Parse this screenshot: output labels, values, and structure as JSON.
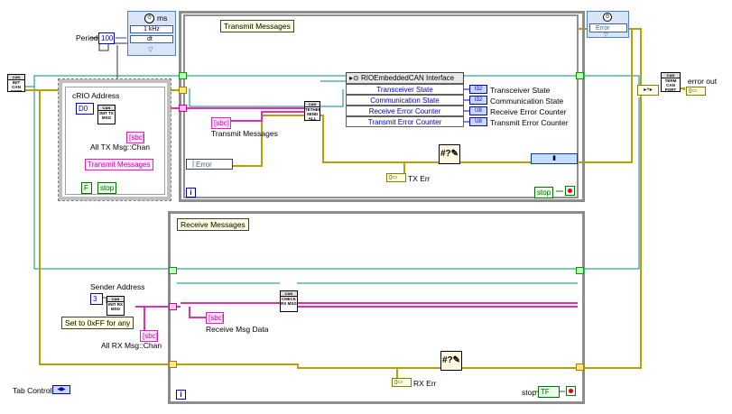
{
  "timing": {
    "unit": "ms",
    "rate": "1 kHz",
    "dt": "dt"
  },
  "period": {
    "label": "Period",
    "value": "100"
  },
  "nodes": {
    "init_can_port": "INIT CAN PORT",
    "term_can_port": "TERM CAN PORT",
    "init_tx_msg": "INIT TX MSG",
    "init_rx_msg": "INIT RX MSG",
    "tether_send_all": "TETHER SEND ALL",
    "check_rx_msg": "CHECK RX MSG"
  },
  "top_error": "Error",
  "error_out": "error out",
  "transmit": {
    "title": "Transmit Messages",
    "crio_label": "cRIO Address",
    "crio_value": "D0",
    "all_tx_label": "All TX Msg::Chan",
    "transmit_ctl": "Transmit Messages",
    "transmit_wire_label": "Transmit Messages",
    "stop_ctl": "stop",
    "bool_const": "F",
    "error_enum": "Error",
    "tx_err": "TX Err",
    "stop_label": "stop",
    "property_node": {
      "header": "RIOEmbeddedCAN Interface",
      "rows": [
        "Transceiver State",
        "Communication State",
        "Receive Error Counter",
        "Transmit Error Counter"
      ],
      "outputs": [
        {
          "type": "I32",
          "label": "Transceiver State"
        },
        {
          "type": "I32",
          "label": "Communication State"
        },
        {
          "type": "U8",
          "label": "Receive Error Counter"
        },
        {
          "type": "U8",
          "label": "Transmit Error Counter"
        }
      ]
    }
  },
  "receive": {
    "title": "Receive Messages",
    "sender_label": "Sender Address",
    "sender_value": "3",
    "note": "Set to 0xFF for any",
    "all_rx_label": "All RX Msg::Chan",
    "rx_data_label": "Receive Msg Data",
    "rx_err": "RX Err",
    "stop_label": "stop",
    "stop_value": "TF"
  },
  "tab_control": "Tab Control",
  "colors": {
    "loop_border": "#8c8c8c",
    "error_wire": "#b8a000",
    "class_wire": "#e030b0",
    "ref_wire": "#00a080"
  }
}
